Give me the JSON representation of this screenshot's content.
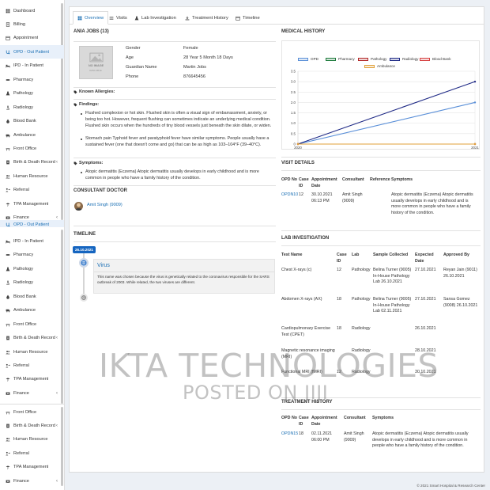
{
  "sidebar": {
    "groups": [
      {
        "items": [
          {
            "label": "Dashboard",
            "icon": "dashboard-icon"
          },
          {
            "label": "Billing",
            "icon": "billing-icon"
          },
          {
            "label": "Appointment",
            "icon": "calendar-icon"
          },
          {
            "label": "OPD - Out Patient",
            "icon": "stethoscope-icon",
            "active": true
          },
          {
            "label": "IPD - In Patient",
            "icon": "bed-icon"
          },
          {
            "label": "Pharmacy",
            "icon": "pills-icon"
          },
          {
            "label": "Pathology",
            "icon": "flask-icon"
          },
          {
            "label": "Radiology",
            "icon": "microscope-icon"
          },
          {
            "label": "Blood Bank",
            "icon": "blood-drop-icon"
          },
          {
            "label": "Ambulance",
            "icon": "ambulance-icon"
          },
          {
            "label": "Front Office",
            "icon": "desk-icon"
          },
          {
            "label": "Birth & Death Record",
            "icon": "records-icon",
            "chevron": true
          },
          {
            "label": "Human Resource",
            "icon": "users-icon"
          },
          {
            "label": "Referral",
            "icon": "referral-icon"
          },
          {
            "label": "TPA Management",
            "icon": "umbrella-icon"
          },
          {
            "label": "Finance",
            "icon": "finance-icon",
            "chevron": true
          }
        ]
      },
      {
        "items": [
          {
            "label": "OPD - Out Patient",
            "icon": "stethoscope-icon",
            "active": true,
            "partial": true
          },
          {
            "label": "IPD - In Patient",
            "icon": "bed-icon"
          },
          {
            "label": "Pharmacy",
            "icon": "pills-icon"
          },
          {
            "label": "Pathology",
            "icon": "flask-icon"
          },
          {
            "label": "Radiology",
            "icon": "microscope-icon"
          },
          {
            "label": "Blood Bank",
            "icon": "blood-drop-icon"
          },
          {
            "label": "Ambulance",
            "icon": "ambulance-icon"
          },
          {
            "label": "Front Office",
            "icon": "desk-icon"
          },
          {
            "label": "Birth & Death Record",
            "icon": "records-icon",
            "chevron": true
          },
          {
            "label": "Human Resource",
            "icon": "users-icon"
          },
          {
            "label": "Referral",
            "icon": "referral-icon"
          },
          {
            "label": "TPA Management",
            "icon": "umbrella-icon"
          },
          {
            "label": "Finance",
            "icon": "finance-icon",
            "chevron": true
          }
        ]
      },
      {
        "items": [
          {
            "label": "Front Office",
            "icon": "desk-icon"
          },
          {
            "label": "Birth & Death Record",
            "icon": "records-icon",
            "chevron": true
          },
          {
            "label": "Human Resource",
            "icon": "users-icon"
          },
          {
            "label": "Referral",
            "icon": "referral-icon"
          },
          {
            "label": "TPA Management",
            "icon": "umbrella-icon"
          },
          {
            "label": "Finance",
            "icon": "finance-icon",
            "chevron": true
          }
        ]
      }
    ]
  },
  "tabs": [
    {
      "label": "Overview",
      "icon": "th-icon",
      "active": true
    },
    {
      "label": "Visits",
      "icon": "list-icon"
    },
    {
      "label": "Lab Investigation",
      "icon": "flask-icon"
    },
    {
      "label": "Treatment History",
      "icon": "download-icon"
    },
    {
      "label": "Timeline",
      "icon": "calendar-icon"
    }
  ],
  "patient": {
    "title": "ANIA JOBS (13)",
    "photo_text": "NO IMAGE",
    "photo_subtext": "AVAILABLE",
    "fields": [
      {
        "label": "Gender",
        "value": "Female"
      },
      {
        "label": "Age",
        "value": "28 Year 5 Month 18 Days"
      },
      {
        "label": "Guardian Name",
        "value": "Martin Jobs"
      },
      {
        "label": "Phone",
        "value": "876645456"
      }
    ]
  },
  "known_allergies": {
    "label": "Known Allergies:"
  },
  "findings": {
    "label": "Findings:",
    "items": [
      "Flushed complexion or hot skin. Flushed skin is often a visual sign of embarrassment, anxiety, or being too hot. However, frequent flushing can sometimes indicate an underlying medical condition. Flushed skin occurs when the hundreds of tiny blood vessels just beneath the skin dilate, or widen.",
      "Stomach pain Typhoid fever and paratyphoid fever have similar symptoms. People usually have a sustained fever (one that doesn't come and go) that can be as high as 103–104°F (39–40°C)."
    ]
  },
  "symptoms": {
    "label": "Symptoms:",
    "items": [
      "Atopic dermatitis (Eczema) Atopic dermatitis usually develops in early childhood and is more common in people who have a family history of the condition."
    ]
  },
  "consultant": {
    "heading": "CONSULTANT DOCTOR",
    "name": "Amit Singh (9009)"
  },
  "timeline": {
    "heading": "TIMELINE",
    "date": "26.10.2021",
    "title": "Virus",
    "text": "This name was chosen because the virus is genetically related to the coronavirus responsible for the SARS outbreak of 2003. While related, the two viruses are different."
  },
  "medical_history": {
    "heading": "MEDICAL HISTORY"
  },
  "chart_data": {
    "type": "line",
    "x": [
      "2020",
      "2021"
    ],
    "ylim": [
      0,
      3.5
    ],
    "yticks": [
      "0",
      "0.5",
      "1.0",
      "1.5",
      "2.0",
      "2.5",
      "3.0",
      "3.5"
    ],
    "legend_position": "top",
    "series": [
      {
        "name": "OPD",
        "color": "#5a8fd8",
        "values": [
          0,
          2
        ]
      },
      {
        "name": "Pharmacy",
        "color": "#1d7a3c",
        "values": [
          0,
          0
        ]
      },
      {
        "name": "Pathology",
        "color": "#b22828",
        "values": [
          0,
          0
        ]
      },
      {
        "name": "Radiology",
        "color": "#1f2a86",
        "values": [
          0,
          3
        ]
      },
      {
        "name": "Blood Bank",
        "color": "#d63f3f",
        "values": [
          0,
          0
        ]
      },
      {
        "name": "Ambulance",
        "color": "#e0a13a",
        "values": [
          0,
          0
        ]
      }
    ]
  },
  "visit_details": {
    "heading": "VISIT DETAILS",
    "columns": [
      "OPD No",
      "Case ID",
      "Appointment Date",
      "Consultant",
      "Reference",
      "Symptoms"
    ],
    "rows": [
      {
        "opd": "OPDN10",
        "case": "12",
        "date": "30.10.2021 06:13 PM",
        "consultant": "Amit Singh (9009)",
        "reference": "",
        "symptoms": "Atopic dermatitis (Eczema) Atopic dermatitis usually develops in early childhood and is more common in people who have a family history of the condition."
      }
    ]
  },
  "lab": {
    "heading": "LAB INVESTIGATION",
    "columns": [
      "Test Name",
      "Case ID",
      "Lab",
      "Sample Collected",
      "Expected Date",
      "Approved By"
    ],
    "rows": [
      {
        "test": "Chest X-rays (c)",
        "case": "12",
        "lab": "Pathology",
        "sample": "Belina Turner (9005) In-House Pathology Lab 26.10.2021",
        "expected": "27.10.2021",
        "approved": "Reyan Jain (9011) 26.10.2021"
      },
      {
        "test": "Abdomen X-rays (AX)",
        "case": "18",
        "lab": "Pathology",
        "sample": "Belina Turner (9005) In-House Pathology Lab 02.11.2021",
        "expected": "27.10.2021",
        "approved": "Sansa Gomez (9008) 26.10.2021"
      },
      {
        "test": "Cardiopulmonary Exercise Test (CPET)",
        "case": "18",
        "lab": "Radiology",
        "sample": "",
        "expected": "26.10.2021",
        "approved": ""
      },
      {
        "test": "Magnetic resonance imaging (MRI)",
        "case": "",
        "lab": "Radiology",
        "sample": "",
        "expected": "28.10.2021",
        "approved": ""
      },
      {
        "test": "Functional MRI (fMRI)",
        "case": "12",
        "lab": "Radiology",
        "sample": "",
        "expected": "30.10.2021",
        "approved": ""
      }
    ]
  },
  "treatment": {
    "heading": "TREATMENT HISTORY",
    "columns": [
      "OPD No",
      "Case ID",
      "Appointment Date",
      "Consultant",
      "Symptoms"
    ],
    "rows": [
      {
        "opd": "OPDN15",
        "case": "18",
        "date": "02.11.2021 06:00 PM",
        "consultant": "Amit Singh (9009)",
        "symptoms": "Atopic dermatitis (Eczema) Atopic dermatitis usually develops in early childhood and is more common in people who have a family history of the condition."
      }
    ]
  },
  "watermark": {
    "line1": "IKTA TECHNOLOGIES",
    "line2": "POSTED ON JIJI"
  },
  "footer": {
    "text": "© 2021 Smart Hospital & Research Center"
  }
}
